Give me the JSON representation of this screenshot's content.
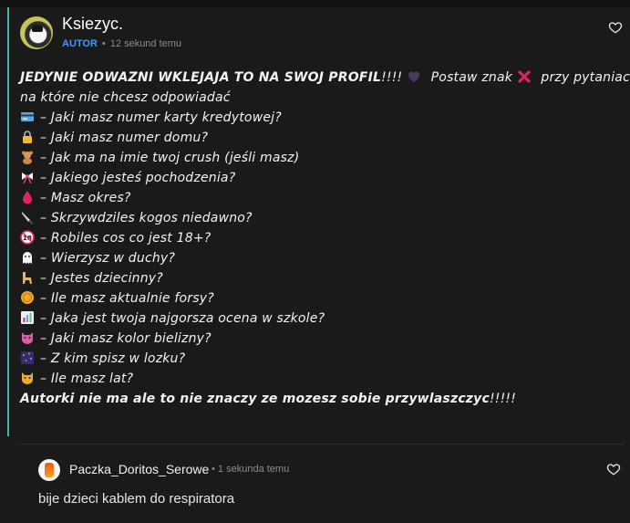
{
  "post": {
    "author": "Ksiezyc.",
    "badge": "AUTOR",
    "separator": "•",
    "time": "12 sekund temu",
    "intro_bold": "JEDYNIE ODWAZNI WKLEJAJA TO NA SWOJ PROFIL",
    "intro_marks": "!!!!",
    "intro_rest_a": "Postaw znak",
    "intro_rest_b": "przy pytaniach",
    "intro_line2": "na które nie chcesz odpowiadać",
    "questions": [
      {
        "icon": "credit-card-icon",
        "text": "– Jaki masz numer karty kredytowej?"
      },
      {
        "icon": "lock-icon",
        "text": "– Jaki masz numer domu?"
      },
      {
        "icon": "teddy-bear-icon",
        "text": "– Jak ma na imie twoj crush (jeśli masz)"
      },
      {
        "icon": "ribbon-icon",
        "text": "– Jakiego jesteś pochodzenia?"
      },
      {
        "icon": "drop-icon",
        "text": "– Masz okres?"
      },
      {
        "icon": "knife-icon",
        "text": "– Skrzywdziles kogos niedawno?"
      },
      {
        "icon": "eighteen-plus-icon",
        "text": "– Robiles cos co jest 18+?"
      },
      {
        "icon": "ghost-icon",
        "text": "– Wierzysz w duchy?"
      },
      {
        "icon": "llama-icon",
        "text": "– Jestes dziecinny?"
      },
      {
        "icon": "coin-icon",
        "text": "– Ile masz aktualnie forsy?"
      },
      {
        "icon": "bar-chart-icon",
        "text": "– Jaka jest twoja najgorsza ocena w szkole?"
      },
      {
        "icon": "cat-face-icon",
        "text": "– Jaki masz kolor bielizny?"
      },
      {
        "icon": "night-sky-icon",
        "text": "– Z kim spisz w lozku?"
      },
      {
        "icon": "cat-icon",
        "text": "– Ile masz lat?"
      }
    ],
    "outro_bold": "Autorki nie ma ale to nie znaczy ze mozesz sobie przywlaszczyc",
    "outro_marks": "!!!!!"
  },
  "reply": {
    "author": "Paczka_Doritos_Serowe",
    "separator": "•",
    "time": "1 sekunda temu",
    "text": "bije dzieci kablem do respiratora"
  },
  "colors": {
    "accent": "#3fb9a6",
    "badge": "#3b9bff",
    "background": "#1a1a1a"
  }
}
